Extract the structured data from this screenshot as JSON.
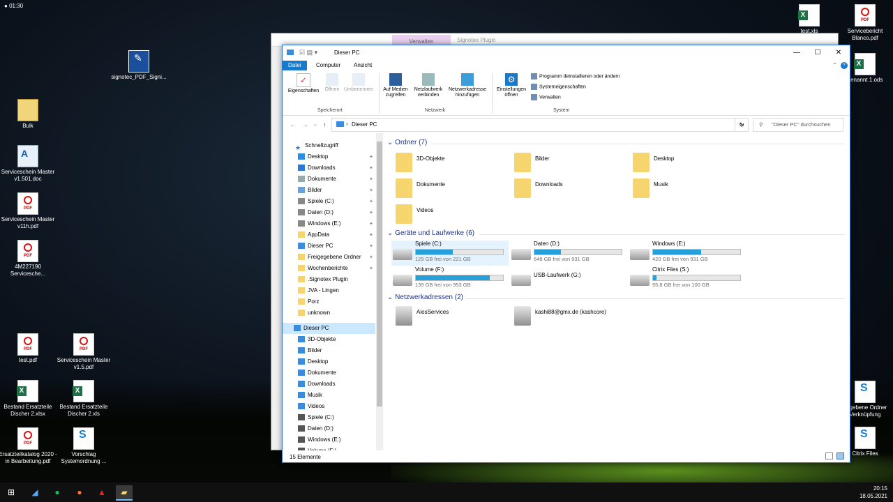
{
  "topbar": {
    "time_small": "01:30"
  },
  "desktop": {
    "icons": [
      {
        "label": "signotec_PDF_Signi...",
        "icon": "signotec-icon"
      },
      {
        "label": "Bulk",
        "icon": "zip-icon"
      },
      {
        "label": "Serviceschein Master v1.501.doc",
        "icon": "word-doc-icon"
      },
      {
        "label": "Serviceschein Master v11h.pdf",
        "icon": "pdf-icon"
      },
      {
        "label": "4M227190 Servicesche...",
        "icon": "pdf-icon"
      },
      {
        "label": "test.pdf",
        "icon": "pdf-icon"
      },
      {
        "label": "Serviceschein Master v1.5.pdf",
        "icon": "pdf-icon"
      },
      {
        "label": "Bestand Ersatzteile Discher 2.xlsx",
        "icon": "excel-icon"
      },
      {
        "label": "Bestand Ersatzteile Discher 2.xls",
        "icon": "excel-icon"
      },
      {
        "label": "Ersatzteilkatalog 2020 - in Bearbeitung.pdf",
        "icon": "pdf-icon"
      },
      {
        "label": "Vorschlag Systemordnung ...",
        "icon": "shortcut-s-icon"
      },
      {
        "label": "test.xls",
        "icon": "excel-icon"
      },
      {
        "label": "Servicebericht Blanco.pdf",
        "icon": "pdf-icon"
      },
      {
        "label": "benannt 1.ods",
        "icon": "excel-icon"
      },
      {
        "label": "gegebene Ordner Verknüpfung",
        "icon": "shortcut-s-icon"
      },
      {
        "label": "Citrix Files",
        "icon": "citrix-icon"
      }
    ]
  },
  "back_window": {
    "context_tab": "Verwalten",
    "title": "Signotex Plugin"
  },
  "window": {
    "title": "Dieser PC",
    "tabs": {
      "file": "Datei",
      "computer": "Computer",
      "view": "Ansicht"
    },
    "ribbon": {
      "location": {
        "properties": "Eigenschaften",
        "open": "Öffnen",
        "rename": "Umbenennen",
        "group": "Speicherort"
      },
      "network": {
        "media": "Auf Medien zugreifen",
        "map_drive": "Netzlaufwerk verbinden",
        "add_location": "Netzwerkadresse hinzufügen",
        "group": "Netzwerk"
      },
      "system": {
        "settings": "Einstellungen öffnen",
        "uninstall": "Programm deinstallieren oder ändern",
        "sysprops": "Systemeigenschaften",
        "manage": "Verwalten",
        "group": "System"
      }
    },
    "address": {
      "path": "Dieser PC",
      "search_placeholder": "\"Dieser PC\" durchsuchen"
    },
    "sidebar": {
      "quick_access": "Schnellzugriff",
      "quick_items": [
        "Desktop",
        "Downloads",
        "Dokumente",
        "Bilder",
        "Spiele (C:)",
        "Daten (D:)",
        "Windows (E:)",
        "AppData",
        "Dieser PC",
        "Freigegebene Ordner",
        "Wochenberichte",
        ".Signotex Plugin",
        "JVA - Lingen",
        "Porz",
        "unknown"
      ],
      "this_pc": "Dieser PC",
      "pc_items": [
        "3D-Objekte",
        "Bilder",
        "Desktop",
        "Dokumente",
        "Downloads",
        "Musik",
        "Videos",
        "Spiele (C:)",
        "Daten (D:)",
        "Windows (E:)",
        "Volume (F:)"
      ]
    },
    "groups": {
      "folders": "Ordner (7)",
      "drives": "Geräte und Laufwerke (6)",
      "network": "Netzwerkadressen (2)"
    },
    "folders": [
      "3D-Objekte",
      "Bilder",
      "Desktop",
      "Dokumente",
      "Downloads",
      "Musik",
      "Videos"
    ],
    "drives": [
      {
        "name": "Spiele (C:)",
        "free": "129 GB frei von 221 GB",
        "used_fraction": 0.42
      },
      {
        "name": "Daten (D:)",
        "free": "648 GB frei von 931 GB",
        "used_fraction": 0.3
      },
      {
        "name": "Windows (E:)",
        "free": "420 GB frei von 931 GB",
        "used_fraction": 0.55
      },
      {
        "name": "Volume (F:)",
        "free": "139 GB frei von 953 GB",
        "used_fraction": 0.85
      },
      {
        "name": "USB-Laufwerk (G:)",
        "free": "",
        "used_fraction": null
      },
      {
        "name": "Citrix Files (S:)",
        "free": "95,8 GB frei von 100 GB",
        "used_fraction": 0.04
      }
    ],
    "network_locations": [
      "AiosServices",
      "kashi88@gmx.de (kashcore)"
    ],
    "status": "15 Elemente"
  },
  "taskbar": {
    "time": "20:15",
    "date": "18.05.2021"
  },
  "colors": {
    "accent": "#1979ca",
    "drive_fill": "#26a0da",
    "group_header": "#1e3287"
  }
}
